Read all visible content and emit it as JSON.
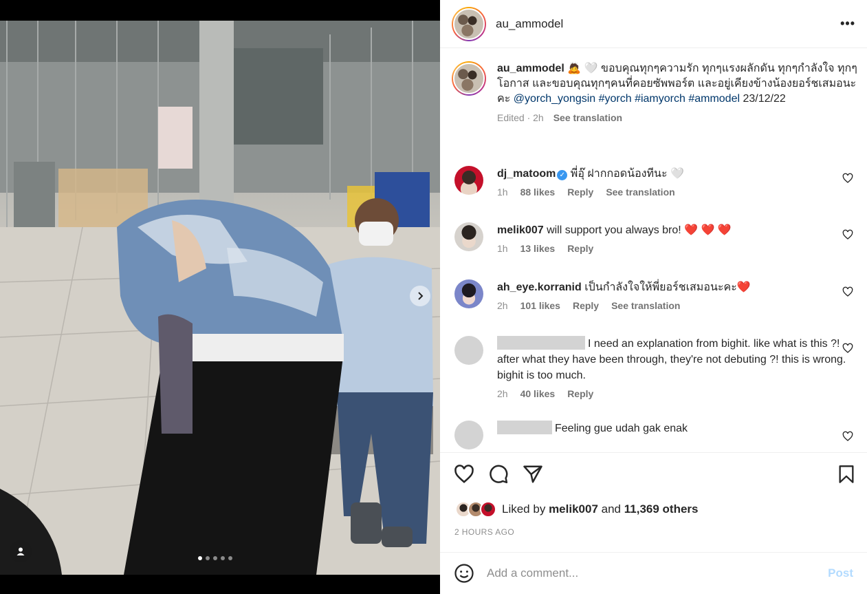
{
  "post": {
    "username": "au_ammodel",
    "more_icon": "more-horizontal-icon",
    "caption": {
      "username": "au_ammodel",
      "emoji": "🙇 🤍",
      "text": "ขอบคุณทุกๆความรัก ทุกๆแรงผลักดัน ทุกๆกำลังใจ ทุกๆโอกาส และขอบคุณทุกๆคนที่คอยซัพพอร์ต และอยู่เคียงข้างน้องยอร์ชเสมอนะคะ",
      "mentions": "@yorch_yongsin #yorch #iamyorch #ammodel",
      "date": "23/12/22",
      "edited": "Edited · 2h",
      "see_translation": "See translation"
    },
    "comments": [
      {
        "username": "dj_matoom",
        "verified": true,
        "text": "พี่อุ๊ ฝากกอดน้องทีนะ 🤍",
        "time": "1h",
        "likes": "88 likes",
        "reply": "Reply",
        "translate": "See translation"
      },
      {
        "username": "melik007",
        "text": "will support you always bro! ❤️ ❤️ ❤️",
        "time": "1h",
        "likes": "13 likes",
        "reply": "Reply"
      },
      {
        "username": "ah_eye.korranid",
        "text": "เป็นกำลังใจให้พี่ยอร์ชเสมอนะคะ❤️",
        "time": "2h",
        "likes": "101 likes",
        "reply": "Reply",
        "translate": "See translation"
      },
      {
        "username": "",
        "text": "I need an explanation from bighit. like what is this ?! after what they have been through, they're not debuting ?! this is wrong. bighit is too much.",
        "time": "2h",
        "likes": "40 likes",
        "reply": "Reply"
      },
      {
        "username": "",
        "text": "Feeling gue udah gak enak"
      }
    ],
    "liked_by": {
      "prefix": "Liked by",
      "user": "melik007",
      "and": "and",
      "others": "11,369 others"
    },
    "timestamp": "2 HOURS AGO",
    "add_comment": {
      "placeholder": "Add a comment...",
      "post_label": "Post"
    }
  },
  "carousel": {
    "total": 5,
    "active_index": 0
  },
  "colors": {
    "link": "#00376b",
    "meta": "#8e8e8e",
    "post_disabled": "#b3dbff",
    "verified": "#3897f0",
    "heart_red": "#ed4956"
  }
}
